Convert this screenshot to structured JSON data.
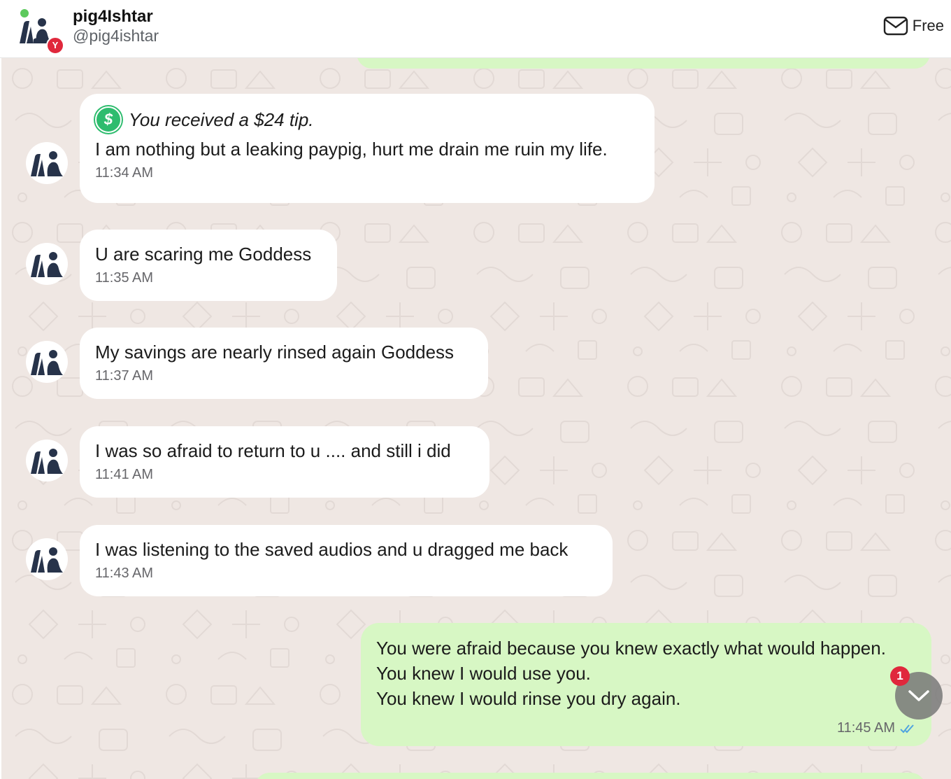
{
  "header": {
    "name": "pig4Ishtar",
    "handle": "@pig4ishtar",
    "badge": "Y",
    "status": "Free"
  },
  "tip": {
    "text": "You received a $24 tip.",
    "icon": "dollar-icon"
  },
  "messages": [
    {
      "text": "I am nothing but a leaking paypig, hurt me drain me ruin my life.",
      "time": "11:34 AM"
    },
    {
      "text": "U are scaring me Goddess",
      "time": "11:35 AM"
    },
    {
      "text": "My savings are nearly rinsed again Goddess",
      "time": "11:37 AM"
    },
    {
      "text": "I was so afraid to return to u .... and still i did",
      "time": "11:41 AM"
    },
    {
      "text": "I was listening to the saved audios and u dragged me back",
      "time": "11:43 AM"
    }
  ],
  "outgoing": {
    "lines": [
      "You were afraid because you knew exactly what would happen.",
      "You knew I would use you.",
      "You knew I would rinse you dry again."
    ],
    "time": "11:45 AM",
    "read_icon": "double-check-icon"
  },
  "scroll_button": {
    "unread_count": "1",
    "icon": "chevron-down-icon"
  },
  "colors": {
    "chat_bg": "#efe7e3",
    "incoming_bubble": "#ffffff",
    "outgoing_bubble": "#d7f7c4",
    "badge_red": "#e0283c",
    "online_green": "#5cc95c",
    "tip_green": "#2ebc6e",
    "read_check_blue": "#4fa3e0"
  }
}
